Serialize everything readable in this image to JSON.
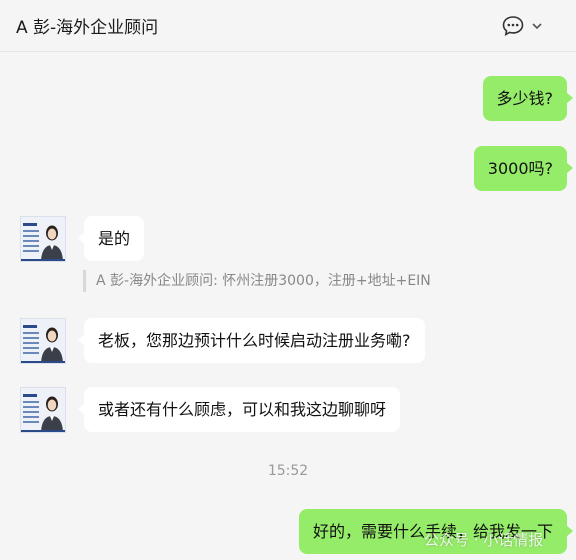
{
  "header": {
    "title": "A 彭-海外企业顾问",
    "more_icon": "chat-bubble-ellipsis-icon",
    "dropdown_icon": "chevron-down-icon"
  },
  "messages": [
    {
      "direction": "outgoing",
      "text": "多少钱?"
    },
    {
      "direction": "outgoing",
      "text": "3000吗?"
    },
    {
      "direction": "incoming",
      "text": "是的",
      "quote": "A 彭-海外企业顾问: 怀州注册3000，注册+地址+EIN"
    },
    {
      "direction": "incoming",
      "text": "老板，您那边预计什么时候启动注册业务嘞?"
    },
    {
      "direction": "incoming",
      "text": "或者还有什么顾虑，可以和我这边聊聊呀"
    },
    {
      "direction": "outgoing",
      "text": "好的，需要什么手续，给我发一下"
    }
  ],
  "timestamp": "15:52",
  "watermark": "公众号 · 小话情报",
  "colors": {
    "outgoing_bubble": "#95ec69",
    "incoming_bubble": "#ffffff",
    "background": "#f5f5f5",
    "avatar_suit": "#3a3f4a"
  }
}
